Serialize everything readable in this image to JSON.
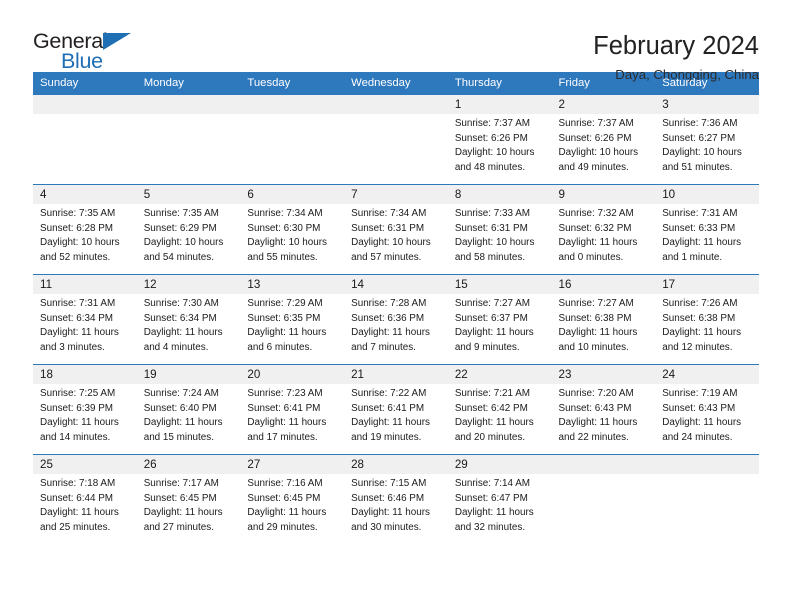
{
  "brand": {
    "word_top": "General",
    "word_bottom": "Blue",
    "accent_color": "#1f6fb5"
  },
  "header": {
    "title": "February 2024",
    "subtitle": "Daya, Chongqing, China"
  },
  "calendar": {
    "header_color": "#2e78bd",
    "daynum_band_color": "#f0f0f0",
    "weekday_headers": [
      "Sunday",
      "Monday",
      "Tuesday",
      "Wednesday",
      "Thursday",
      "Friday",
      "Saturday"
    ],
    "labels": {
      "sunrise": "Sunrise:",
      "sunset": "Sunset:",
      "daylight": "Daylight:"
    },
    "weeks": [
      [
        {
          "day": "",
          "lines": []
        },
        {
          "day": "",
          "lines": []
        },
        {
          "day": "",
          "lines": []
        },
        {
          "day": "",
          "lines": []
        },
        {
          "day": "1",
          "lines": [
            "Sunrise: 7:37 AM",
            "Sunset: 6:26 PM",
            "Daylight: 10 hours",
            "and 48 minutes."
          ]
        },
        {
          "day": "2",
          "lines": [
            "Sunrise: 7:37 AM",
            "Sunset: 6:26 PM",
            "Daylight: 10 hours",
            "and 49 minutes."
          ]
        },
        {
          "day": "3",
          "lines": [
            "Sunrise: 7:36 AM",
            "Sunset: 6:27 PM",
            "Daylight: 10 hours",
            "and 51 minutes."
          ]
        }
      ],
      [
        {
          "day": "4",
          "lines": [
            "Sunrise: 7:35 AM",
            "Sunset: 6:28 PM",
            "Daylight: 10 hours",
            "and 52 minutes."
          ]
        },
        {
          "day": "5",
          "lines": [
            "Sunrise: 7:35 AM",
            "Sunset: 6:29 PM",
            "Daylight: 10 hours",
            "and 54 minutes."
          ]
        },
        {
          "day": "6",
          "lines": [
            "Sunrise: 7:34 AM",
            "Sunset: 6:30 PM",
            "Daylight: 10 hours",
            "and 55 minutes."
          ]
        },
        {
          "day": "7",
          "lines": [
            "Sunrise: 7:34 AM",
            "Sunset: 6:31 PM",
            "Daylight: 10 hours",
            "and 57 minutes."
          ]
        },
        {
          "day": "8",
          "lines": [
            "Sunrise: 7:33 AM",
            "Sunset: 6:31 PM",
            "Daylight: 10 hours",
            "and 58 minutes."
          ]
        },
        {
          "day": "9",
          "lines": [
            "Sunrise: 7:32 AM",
            "Sunset: 6:32 PM",
            "Daylight: 11 hours",
            "and 0 minutes."
          ]
        },
        {
          "day": "10",
          "lines": [
            "Sunrise: 7:31 AM",
            "Sunset: 6:33 PM",
            "Daylight: 11 hours",
            "and 1 minute."
          ]
        }
      ],
      [
        {
          "day": "11",
          "lines": [
            "Sunrise: 7:31 AM",
            "Sunset: 6:34 PM",
            "Daylight: 11 hours",
            "and 3 minutes."
          ]
        },
        {
          "day": "12",
          "lines": [
            "Sunrise: 7:30 AM",
            "Sunset: 6:34 PM",
            "Daylight: 11 hours",
            "and 4 minutes."
          ]
        },
        {
          "day": "13",
          "lines": [
            "Sunrise: 7:29 AM",
            "Sunset: 6:35 PM",
            "Daylight: 11 hours",
            "and 6 minutes."
          ]
        },
        {
          "day": "14",
          "lines": [
            "Sunrise: 7:28 AM",
            "Sunset: 6:36 PM",
            "Daylight: 11 hours",
            "and 7 minutes."
          ]
        },
        {
          "day": "15",
          "lines": [
            "Sunrise: 7:27 AM",
            "Sunset: 6:37 PM",
            "Daylight: 11 hours",
            "and 9 minutes."
          ]
        },
        {
          "day": "16",
          "lines": [
            "Sunrise: 7:27 AM",
            "Sunset: 6:38 PM",
            "Daylight: 11 hours",
            "and 10 minutes."
          ]
        },
        {
          "day": "17",
          "lines": [
            "Sunrise: 7:26 AM",
            "Sunset: 6:38 PM",
            "Daylight: 11 hours",
            "and 12 minutes."
          ]
        }
      ],
      [
        {
          "day": "18",
          "lines": [
            "Sunrise: 7:25 AM",
            "Sunset: 6:39 PM",
            "Daylight: 11 hours",
            "and 14 minutes."
          ]
        },
        {
          "day": "19",
          "lines": [
            "Sunrise: 7:24 AM",
            "Sunset: 6:40 PM",
            "Daylight: 11 hours",
            "and 15 minutes."
          ]
        },
        {
          "day": "20",
          "lines": [
            "Sunrise: 7:23 AM",
            "Sunset: 6:41 PM",
            "Daylight: 11 hours",
            "and 17 minutes."
          ]
        },
        {
          "day": "21",
          "lines": [
            "Sunrise: 7:22 AM",
            "Sunset: 6:41 PM",
            "Daylight: 11 hours",
            "and 19 minutes."
          ]
        },
        {
          "day": "22",
          "lines": [
            "Sunrise: 7:21 AM",
            "Sunset: 6:42 PM",
            "Daylight: 11 hours",
            "and 20 minutes."
          ]
        },
        {
          "day": "23",
          "lines": [
            "Sunrise: 7:20 AM",
            "Sunset: 6:43 PM",
            "Daylight: 11 hours",
            "and 22 minutes."
          ]
        },
        {
          "day": "24",
          "lines": [
            "Sunrise: 7:19 AM",
            "Sunset: 6:43 PM",
            "Daylight: 11 hours",
            "and 24 minutes."
          ]
        }
      ],
      [
        {
          "day": "25",
          "lines": [
            "Sunrise: 7:18 AM",
            "Sunset: 6:44 PM",
            "Daylight: 11 hours",
            "and 25 minutes."
          ]
        },
        {
          "day": "26",
          "lines": [
            "Sunrise: 7:17 AM",
            "Sunset: 6:45 PM",
            "Daylight: 11 hours",
            "and 27 minutes."
          ]
        },
        {
          "day": "27",
          "lines": [
            "Sunrise: 7:16 AM",
            "Sunset: 6:45 PM",
            "Daylight: 11 hours",
            "and 29 minutes."
          ]
        },
        {
          "day": "28",
          "lines": [
            "Sunrise: 7:15 AM",
            "Sunset: 6:46 PM",
            "Daylight: 11 hours",
            "and 30 minutes."
          ]
        },
        {
          "day": "29",
          "lines": [
            "Sunrise: 7:14 AM",
            "Sunset: 6:47 PM",
            "Daylight: 11 hours",
            "and 32 minutes."
          ]
        },
        {
          "day": "",
          "lines": []
        },
        {
          "day": "",
          "lines": []
        }
      ]
    ]
  }
}
